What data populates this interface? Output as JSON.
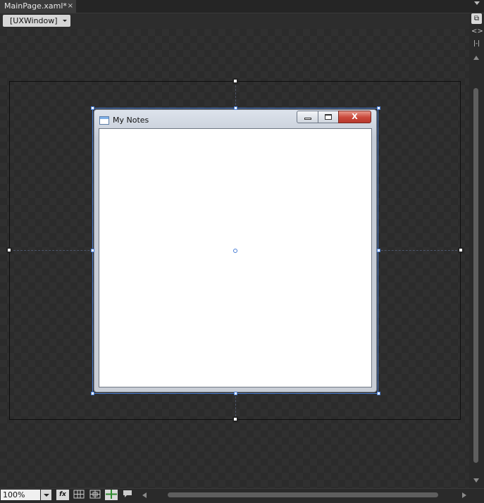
{
  "document_tab": {
    "title": "MainPage.xaml*",
    "close_glyph": "×"
  },
  "breadcrumb": {
    "label": "[UXWindow]"
  },
  "right_tools": [
    {
      "icon": "design-view-icon",
      "glyph": "⧉"
    },
    {
      "icon": "xaml-view-icon",
      "glyph": "<>"
    },
    {
      "icon": "split-view-icon",
      "glyph": "|-|"
    }
  ],
  "designed_window": {
    "title": "My Notes",
    "close_glyph": "X"
  },
  "bottom_bar": {
    "zoom": "100%",
    "fx_label": "fx"
  },
  "colors": {
    "canvas": "#2b2b2b",
    "selection": "#4a7fd6",
    "close_button": "#c9473a"
  }
}
